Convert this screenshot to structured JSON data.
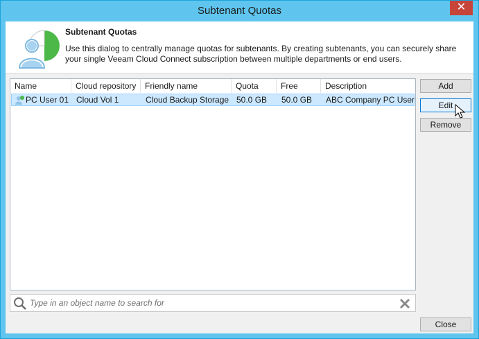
{
  "window": {
    "title": "Subtenant Quotas",
    "close_glyph": "✕"
  },
  "header": {
    "title": "Subtenant Quotas",
    "description": "Use this dialog to centrally manage quotas for subtenants. By creating subtenants, you can securely share your single Veeam Cloud Connect subscription between multiple departments or end users."
  },
  "table": {
    "columns": [
      "Name",
      "Cloud repository",
      "Friendly name",
      "Quota",
      "Free",
      "Description"
    ],
    "rows": [
      {
        "name": "PC User 01",
        "cloud_repository": "Cloud Vol 1",
        "friendly_name": "Cloud Backup Storage",
        "quota": "50.0 GB",
        "free": "50.0 GB",
        "description": "ABC Company PC User"
      }
    ]
  },
  "buttons": {
    "add": "Add",
    "edit": "Edit",
    "remove": "Remove",
    "close": "Close"
  },
  "search": {
    "placeholder": "Type in an object name to search for"
  },
  "colors": {
    "titlebar": "#5fc5ee",
    "selection": "#cce8ff",
    "accent_green": "#4cb848",
    "user_icon": "#6eb3e0"
  }
}
